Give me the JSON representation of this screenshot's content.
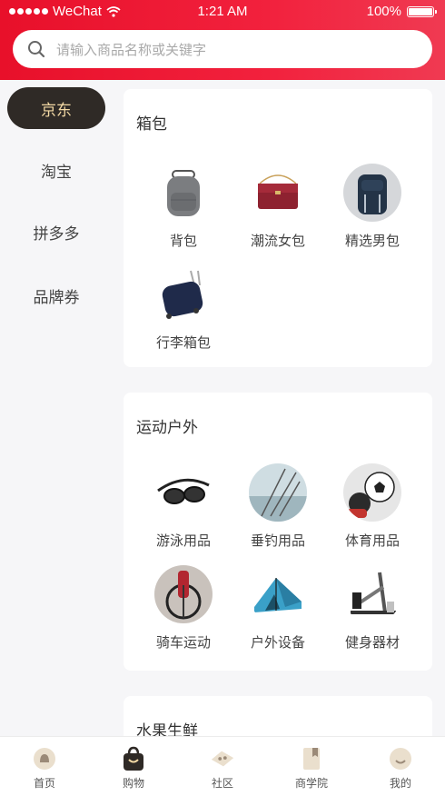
{
  "status_bar": {
    "carrier": "WeChat",
    "time": "1:21 AM",
    "battery": "100%"
  },
  "search": {
    "placeholder": "请输入商品名称或关键字"
  },
  "sidebar": {
    "items": [
      {
        "label": "京东",
        "active": true
      },
      {
        "label": "淘宝"
      },
      {
        "label": "拼多多"
      },
      {
        "label": "品牌券"
      }
    ]
  },
  "sections": [
    {
      "title": "箱包",
      "items": [
        {
          "label": "背包",
          "icon": "backpack-icon"
        },
        {
          "label": "潮流女包",
          "icon": "handbag-icon"
        },
        {
          "label": "精选男包",
          "icon": "mens-bag-icon"
        },
        {
          "label": "行李箱包",
          "icon": "luggage-icon"
        }
      ]
    },
    {
      "title": "运动户外",
      "items": [
        {
          "label": "游泳用品",
          "icon": "swim-goggles-icon"
        },
        {
          "label": "垂钓用品",
          "icon": "fishing-icon"
        },
        {
          "label": "体育用品",
          "icon": "soccer-ball-icon"
        },
        {
          "label": "骑车运动",
          "icon": "bicycle-icon"
        },
        {
          "label": "户外设备",
          "icon": "tent-icon"
        },
        {
          "label": "健身器材",
          "icon": "fitness-machine-icon"
        }
      ]
    },
    {
      "title": "水果生鲜",
      "items": []
    }
  ],
  "tabbar": {
    "items": [
      {
        "label": "首页",
        "icon": "home-icon"
      },
      {
        "label": "购物",
        "icon": "shopping-bag-icon",
        "active": true
      },
      {
        "label": "社区",
        "icon": "community-icon"
      },
      {
        "label": "商学院",
        "icon": "book-icon"
      },
      {
        "label": "我的",
        "icon": "profile-icon"
      }
    ]
  },
  "colors": {
    "header": "#e8102a",
    "sidebar_active_bg": "#2f2a26",
    "sidebar_active_text": "#f3d9a4"
  }
}
